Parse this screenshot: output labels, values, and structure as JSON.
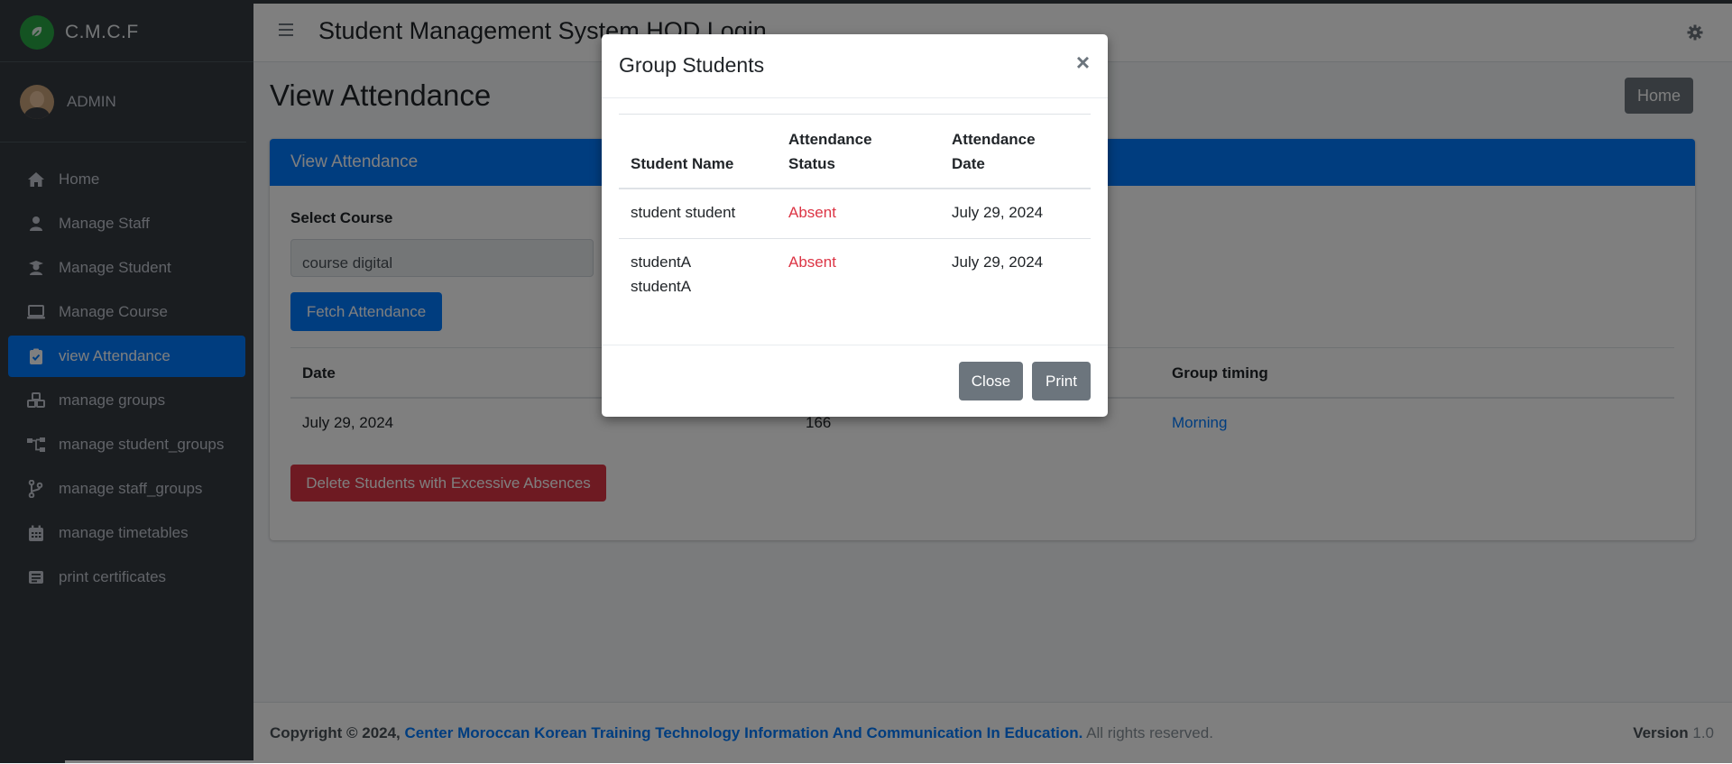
{
  "brand": {
    "name": "C.M.C.F",
    "logo_icon": "leaf-logo-icon"
  },
  "user": {
    "name": "ADMIN"
  },
  "sidebar": {
    "items": [
      {
        "label": "Home",
        "icon": "home-icon"
      },
      {
        "label": "Manage Staff",
        "icon": "user-icon"
      },
      {
        "label": "Manage Student",
        "icon": "student-icon"
      },
      {
        "label": "Manage Course",
        "icon": "laptop-icon"
      },
      {
        "label": "view Attendance",
        "icon": "clipboard-check-icon",
        "active": true
      },
      {
        "label": "manage groups",
        "icon": "cubes-icon"
      },
      {
        "label": "manage student_groups",
        "icon": "sitemap-icon"
      },
      {
        "label": "manage staff_groups",
        "icon": "code-branch-icon"
      },
      {
        "label": "manage timetables",
        "icon": "calendar-icon"
      },
      {
        "label": "print certificates",
        "icon": "certificate-icon"
      }
    ]
  },
  "header": {
    "title": "Student Management System HOD Login"
  },
  "main": {
    "page_title": "View Attendance",
    "home_button": "Home",
    "card_title": "View Attendance",
    "select_course_label": "Select Course",
    "course_value": "course digital",
    "fetch_button": "Fetch Attendance",
    "table": {
      "headers": [
        "Date",
        "Group timing"
      ],
      "row": {
        "date": "July 29, 2024",
        "count": "166",
        "timing": "Morning"
      }
    },
    "delete_button": "Delete Students with Excessive Absences"
  },
  "footer": {
    "copyright": "Copyright © 2024,",
    "org": "Center Moroccan Korean Training Technology Information And Communication In Education.",
    "rights": "All rights reserved.",
    "version_label": "Version",
    "version": "1.0"
  },
  "modal": {
    "title": "Group Students",
    "close_symbol": "×",
    "headers": {
      "name": "Student Name",
      "status_1": "Attendance",
      "status_2": "Status",
      "date_1": "Attendance",
      "date_2": "Date"
    },
    "rows": [
      {
        "name_1": "student student",
        "name_2": "",
        "status": "Absent",
        "date": "July 29, 2024"
      },
      {
        "name_1": "studentA",
        "name_2": "studentA",
        "status": "Absent",
        "date": "July 29, 2024"
      }
    ],
    "close_button": "Close",
    "print_button": "Print"
  },
  "colors": {
    "primary": "#007bff",
    "danger": "#dc3545",
    "secondary": "#6c757d",
    "sidebar": "#343a40"
  }
}
